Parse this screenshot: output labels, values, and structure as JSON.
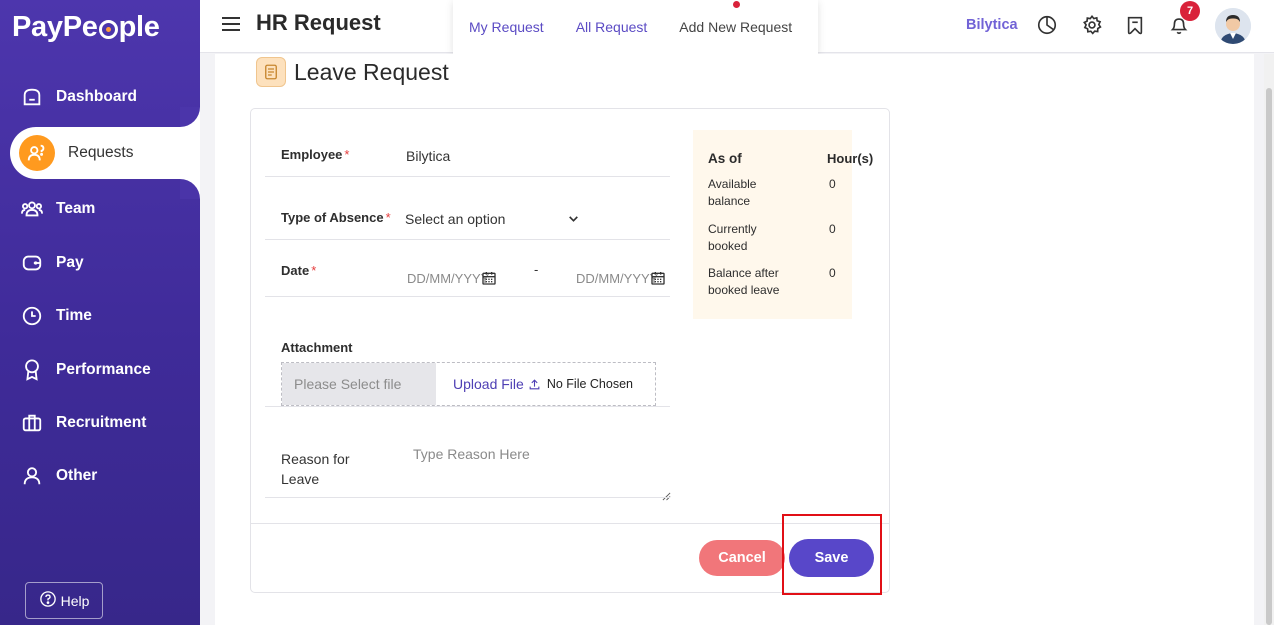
{
  "brand": {
    "name_pre": "PayPe",
    "name_post": "ple"
  },
  "sidebar": {
    "items": [
      {
        "label": "Dashboard",
        "icon": "home-icon"
      },
      {
        "label": "Requests",
        "icon": "requests-icon",
        "active": true
      },
      {
        "label": "Team",
        "icon": "team-icon"
      },
      {
        "label": "Pay",
        "icon": "wallet-icon"
      },
      {
        "label": "Time",
        "icon": "clock-icon"
      },
      {
        "label": "Performance",
        "icon": "award-icon"
      },
      {
        "label": "Recruitment",
        "icon": "briefcase-icon"
      },
      {
        "label": "Other",
        "icon": "user-icon"
      }
    ],
    "help_label": "Help"
  },
  "header": {
    "title": "HR Request",
    "tabs": [
      {
        "label": "My Request"
      },
      {
        "label": "All Request"
      },
      {
        "label": "Add New Request",
        "active": true
      }
    ],
    "company": "Bilytica",
    "notification_count": "7"
  },
  "section": {
    "title": "Leave Request"
  },
  "form": {
    "employee": {
      "label": "Employee",
      "value": "Bilytica"
    },
    "absence": {
      "label": "Type of Absence",
      "value": "Select an option"
    },
    "date": {
      "label": "Date",
      "from_placeholder": "DD/MM/YYYY",
      "separator": "-",
      "to_placeholder": "DD/MM/YYYY"
    },
    "attachment": {
      "label": "Attachment",
      "select_placeholder": "Please Select file",
      "upload_label": "Upload File",
      "no_file": "No File Chosen"
    },
    "reason": {
      "label_line1": "Reason for",
      "label_line2": "Leave",
      "placeholder": "Type Reason Here"
    }
  },
  "balance": {
    "as_of_label": "As of",
    "hours_label": "Hour(s)",
    "rows": [
      {
        "line1": "Available",
        "line2": "balance",
        "value": "0"
      },
      {
        "line1": "Currently",
        "line2": "booked",
        "value": "0"
      },
      {
        "line1": "Balance after",
        "line2": "booked leave",
        "value": "0"
      }
    ]
  },
  "actions": {
    "cancel_label": "Cancel",
    "save_label": "Save"
  },
  "colors": {
    "sidebar": "#4d36ad",
    "accent": "#5847c9",
    "cancel": "#f1767a",
    "active_icon": "#ff9a1f",
    "highlight": "#e10f16",
    "balance_bg": "#fff8ec"
  }
}
